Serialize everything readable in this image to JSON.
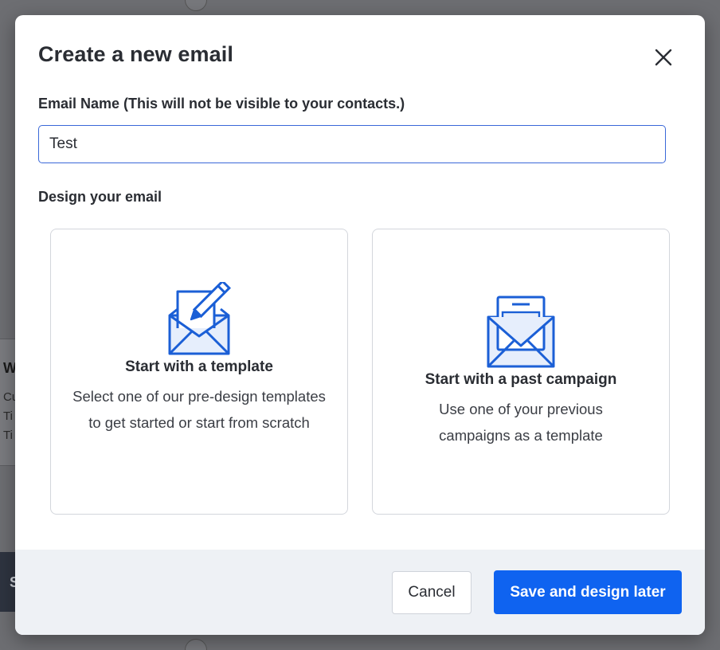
{
  "background": {
    "card_title": "W",
    "card_lines": [
      "Cu",
      "Ti",
      "Ti"
    ],
    "bar_label": "S"
  },
  "modal": {
    "title": "Create a new email",
    "close_icon": "close-icon",
    "email_name_label": "Email Name (This will not be visible to your contacts.)",
    "email_name_value": "Test",
    "design_label": "Design your email",
    "options": [
      {
        "icon": "envelope-pencil-icon",
        "title": "Start with a template",
        "description": "Select one of our pre-design templates to get started or start from scratch"
      },
      {
        "icon": "envelope-letter-icon",
        "title": "Start with a past campaign",
        "description": "Use one of your previous campaigns as a template"
      }
    ],
    "footer": {
      "cancel_label": "Cancel",
      "save_label": "Save and design later"
    }
  },
  "colors": {
    "primary": "#0f63f0",
    "input_focus": "#3a68d8",
    "icon_blue": "#1b5fd6",
    "icon_fill": "#e6eefc"
  }
}
